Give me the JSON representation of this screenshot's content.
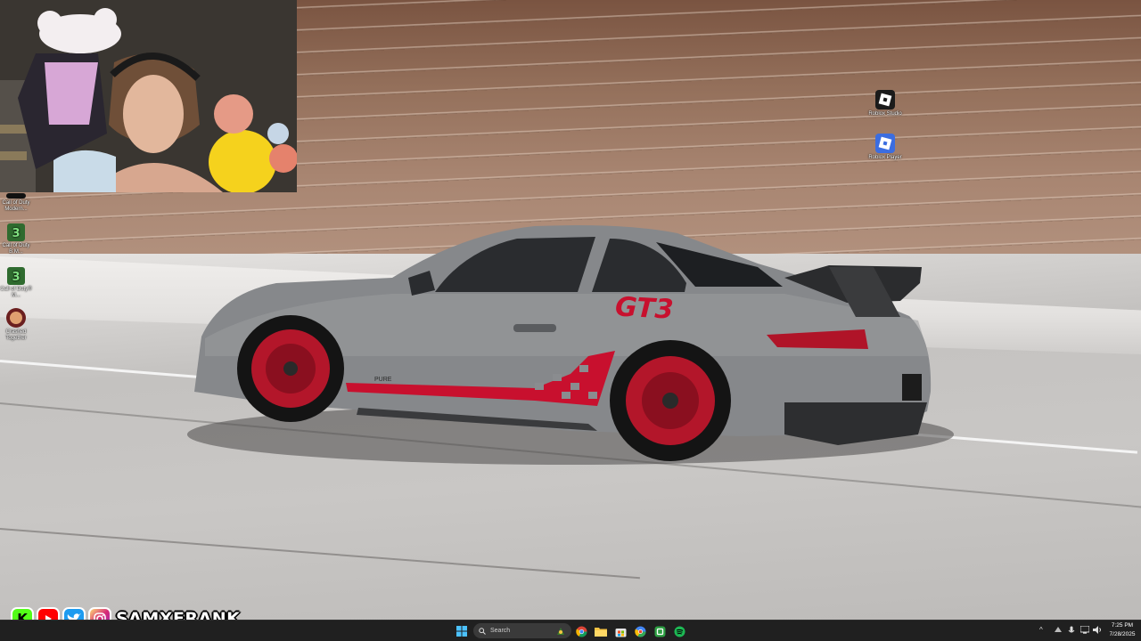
{
  "desktop": {
    "icons": [
      {
        "label": "Roblox Studio",
        "icon": "roblox-studio-icon"
      },
      {
        "label": "Roblox Player",
        "icon": "roblox-player-icon"
      },
      {
        "label": "Call of Duty Modern...",
        "icon": "call-of-duty-mw-icon"
      },
      {
        "label": "Call of Duty B.M...",
        "icon": "call-of-duty-bo-icon"
      },
      {
        "label": "Call of Duty® M...",
        "icon": "call-of-duty-icon"
      },
      {
        "label": "Crashed Together",
        "icon": "crashed-together-icon"
      }
    ]
  },
  "wallpaper": {
    "car_badge": "GT3",
    "side_text": "PURE"
  },
  "overlay": {
    "handle": "SAMXFRANK",
    "socials": [
      "kick-icon",
      "youtube-icon",
      "twitter-icon",
      "instagram-icon"
    ]
  },
  "taskbar": {
    "search_placeholder": "Search",
    "pinned": [
      "start-icon",
      "search-icon",
      "chrome-icon",
      "file-explorer-icon",
      "store-icon",
      "chrome-canary-icon",
      "xbox-icon",
      "spotify-icon"
    ],
    "tray": {
      "chevron": "^"
    },
    "time": "7:25 PM",
    "date": "7/28/2025"
  },
  "colors": {
    "taskbar": "#202020",
    "accent_red": "#c8102e",
    "car_grey": "#8c8e91"
  }
}
